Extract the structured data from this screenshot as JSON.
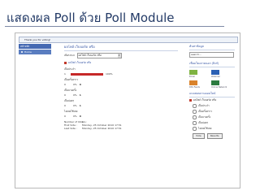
{
  "slide_title": "แสดงผล Poll ด้วย Poll Module",
  "notice": "Thank you for voting!",
  "left_menu": {
    "header": "หน้าหลัก",
    "item": "Home"
  },
  "main": {
    "title": "ผลโพล์ เว็บบอร์ด หรือ",
    "select_label": "เลือก Poll",
    "select_value": "ผลโพล์ เว็บบอร์ด หรือ",
    "poll_question": "ผลโพล์ เว็บบอร์ด หรือ",
    "options": [
      {
        "label": "เป็นประจำ",
        "count": "1",
        "percent": 100,
        "pct_text": "100%",
        "votes": ""
      },
      {
        "label": "เป็นครั้งคราว",
        "count": "0",
        "percent": 0,
        "pct_text": "0%",
        "votes": "0"
      },
      {
        "label": "เป็นบางครั้ง",
        "count": "0",
        "percent": 0,
        "pct_text": "0%",
        "votes": "1"
      },
      {
        "label": "เป็นบ่อยๆ",
        "count": "0",
        "percent": 0,
        "pct_text": "0%",
        "votes": "1"
      },
      {
        "label": "ไม่เคยใช้เลย",
        "count": "0",
        "percent": 0,
        "pct_text": "0%",
        "votes": "0"
      }
    ],
    "stats": [
      {
        "key": "Number of Voters :",
        "value": "1"
      },
      {
        "key": "First Vote :",
        "value": "Monday, 25 October 2010 17:51"
      },
      {
        "key": "Last Vote :",
        "value": "Monday, 25 October 2010 17:51"
      }
    ]
  },
  "right": {
    "search_heading": "ค้นหาข้อมูล",
    "search_value": "search...",
    "links_heading": "เชื่อมโยงภายนอก (ลิงก์)",
    "links": [
      {
        "label": "Email",
        "icon": "envelope-icon",
        "color": "#7fb342"
      },
      {
        "label": "Webmail",
        "icon": "web-logo-icon",
        "color": "#2b5fb3"
      },
      {
        "label": "RSS Feeds",
        "icon": "rss-icon",
        "color": "#d9822b"
      },
      {
        "label": "Online Network",
        "icon": "network-logo-icon",
        "color": "#2b7a3f"
      }
    ],
    "poll_heading": "แบบสอบถามออนไลน์",
    "poll_question": "ผลโพล์ เว็บบอร์ด หรือ",
    "poll_options": [
      "เป็นประจำ",
      "เป็นครั้งคราว",
      "เป็นบางครั้ง",
      "เป็นบ่อยๆ",
      "ไม่เคยใช้เลย"
    ],
    "vote_button": "Vote",
    "results_button": "Results"
  }
}
